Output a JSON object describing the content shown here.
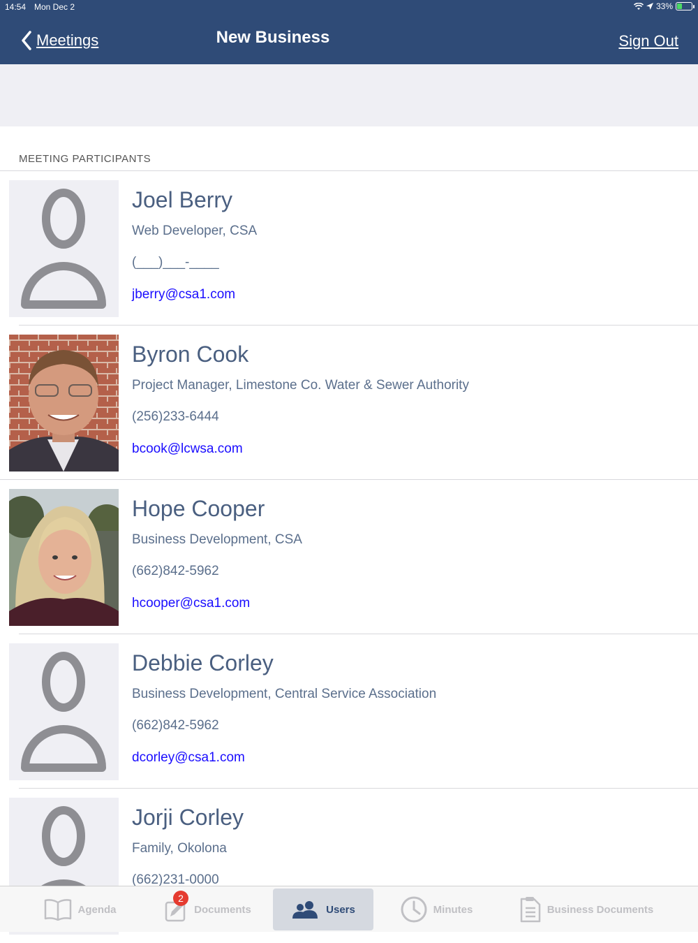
{
  "status_bar": {
    "time": "14:54",
    "date": "Mon Dec 2",
    "battery": "33%"
  },
  "nav": {
    "back_label": "Meetings",
    "title": "New Business",
    "sign_out": "Sign Out"
  },
  "section_title": "MEETING PARTICIPANTS",
  "participants": [
    {
      "name": "Joel Berry",
      "title": "Web Developer, CSA",
      "phone": "(___)___-____",
      "email": "jberry@csa1.com",
      "avatar": "placeholder"
    },
    {
      "name": "Byron Cook",
      "title": "Project Manager, Limestone Co. Water & Sewer Authority",
      "phone": "(256)233-6444",
      "email": "bcook@lcwsa.com",
      "avatar": "photo-man"
    },
    {
      "name": "Hope Cooper",
      "title": "Business Development, CSA",
      "phone": "(662)842-5962",
      "email": "hcooper@csa1.com",
      "avatar": "photo-woman"
    },
    {
      "name": "Debbie Corley",
      "title": "Business Development, Central Service Association",
      "phone": "(662)842-5962",
      "email": "dcorley@csa1.com",
      "avatar": "placeholder"
    },
    {
      "name": "Jorji Corley",
      "title": "Family, Okolona",
      "phone": "(662)231-0000",
      "email": "",
      "avatar": "placeholder"
    }
  ],
  "tabs": {
    "agenda": "Agenda",
    "documents": "Documents",
    "documents_badge": "2",
    "users": "Users",
    "minutes": "Minutes",
    "business_documents": "Business Documents",
    "active": "users"
  },
  "colors": {
    "header": "#2f4b77",
    "link": "#1a0dff",
    "badge": "#e53b30",
    "battery": "#4cd964"
  },
  "battery_level": 0.33
}
